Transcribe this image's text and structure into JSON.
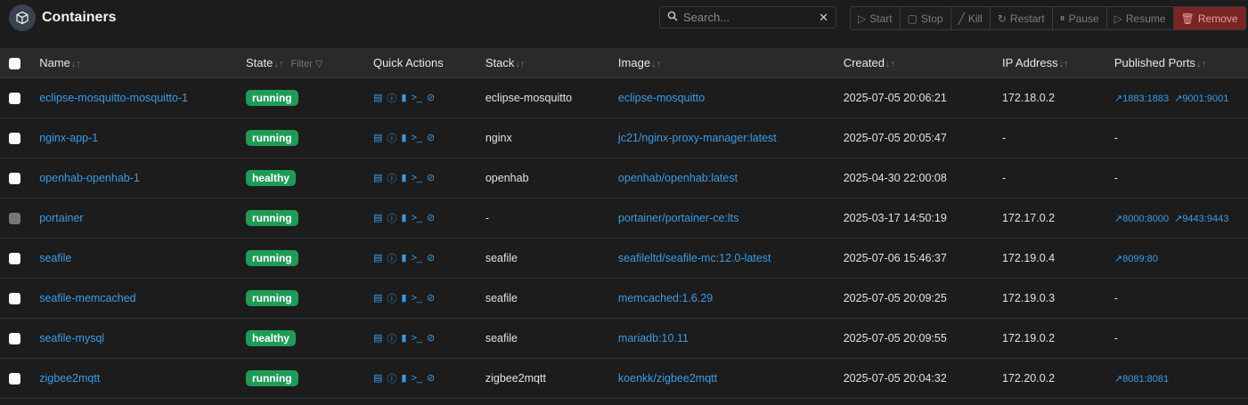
{
  "header": {
    "title": "Containers",
    "logo_icon": "cube-icon"
  },
  "search": {
    "placeholder": "Search..."
  },
  "toolbar": [
    {
      "label": "Start",
      "icon": "play-icon"
    },
    {
      "label": "Stop",
      "icon": "stop-icon"
    },
    {
      "label": "Kill",
      "icon": "kill-icon"
    },
    {
      "label": "Restart",
      "icon": "restart-icon"
    },
    {
      "label": "Pause",
      "icon": "pause-icon"
    },
    {
      "label": "Resume",
      "icon": "play-icon"
    },
    {
      "label": "Remove",
      "icon": "trash-icon"
    }
  ],
  "columns": {
    "name": "Name",
    "state": "State",
    "filter": "Filter",
    "quick_actions": "Quick Actions",
    "stack": "Stack",
    "image": "Image",
    "created": "Created",
    "ip": "IP Address",
    "ports": "Published Ports"
  },
  "colors": {
    "link": "#3b9be6",
    "badge": "#1f9b57",
    "remove": "#7a2424"
  },
  "rows": [
    {
      "name": "eclipse-mosquitto-mosquitto-1",
      "state": "running",
      "stack": "eclipse-mosquitto",
      "image": "eclipse-mosquitto",
      "created": "2025-07-05 20:06:21",
      "ip": "172.18.0.2",
      "ports": [
        "1883:1883",
        "9001:9001"
      ],
      "ports_text": "",
      "disabled": false
    },
    {
      "name": "nginx-app-1",
      "state": "running",
      "stack": "nginx",
      "image": "jc21/nginx-proxy-manager:latest",
      "created": "2025-07-05 20:05:47",
      "ip": "-",
      "ports": [],
      "ports_text": "-",
      "disabled": false
    },
    {
      "name": "openhab-openhab-1",
      "state": "healthy",
      "stack": "openhab",
      "image": "openhab/openhab:latest",
      "created": "2025-04-30 22:00:08",
      "ip": "-",
      "ports": [],
      "ports_text": "-",
      "disabled": false
    },
    {
      "name": "portainer",
      "state": "running",
      "stack": "-",
      "image": "portainer/portainer-ce:lts",
      "created": "2025-03-17 14:50:19",
      "ip": "172.17.0.2",
      "ports": [
        "8000:8000",
        "9443:9443"
      ],
      "ports_text": "",
      "disabled": true
    },
    {
      "name": "seafile",
      "state": "running",
      "stack": "seafile",
      "image": "seafileltd/seafile-mc:12.0-latest",
      "created": "2025-07-06 15:46:37",
      "ip": "172.19.0.4",
      "ports": [
        "8099:80"
      ],
      "ports_text": "",
      "disabled": false
    },
    {
      "name": "seafile-memcached",
      "state": "running",
      "stack": "seafile",
      "image": "memcached:1.6.29",
      "created": "2025-07-05 20:09:25",
      "ip": "172.19.0.3",
      "ports": [],
      "ports_text": "-",
      "disabled": false
    },
    {
      "name": "seafile-mysql",
      "state": "healthy",
      "stack": "seafile",
      "image": "mariadb:10.11",
      "created": "2025-07-05 20:09:55",
      "ip": "172.19.0.2",
      "ports": [],
      "ports_text": "-",
      "disabled": false
    },
    {
      "name": "zigbee2mqtt",
      "state": "running",
      "stack": "zigbee2mqtt",
      "image": "koenkk/zigbee2mqtt",
      "created": "2025-07-05 20:04:32",
      "ip": "172.20.0.2",
      "ports": [
        "8081:8081"
      ],
      "ports_text": "",
      "disabled": false
    }
  ]
}
